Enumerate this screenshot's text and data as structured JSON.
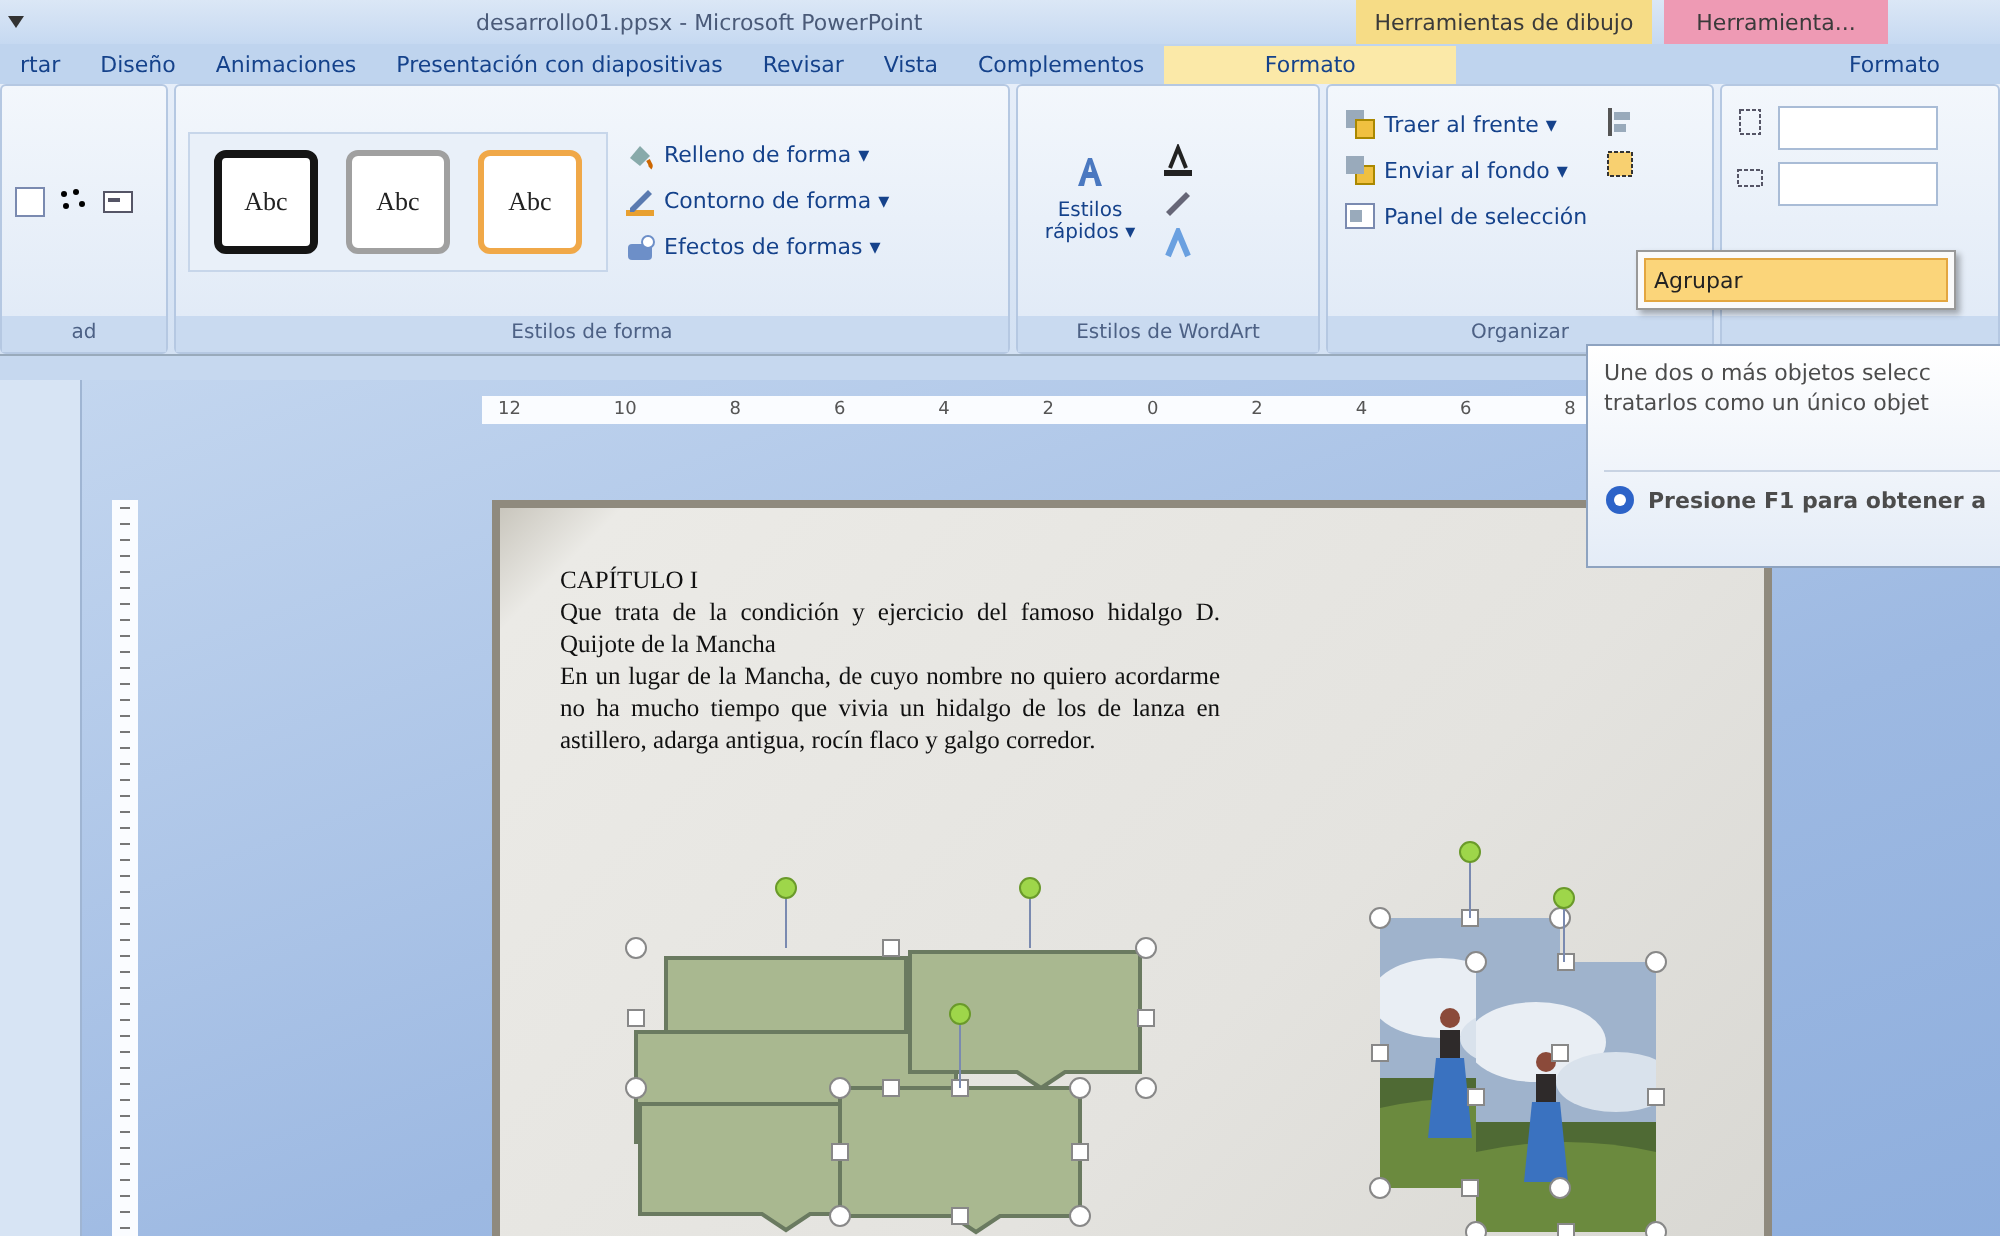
{
  "window": {
    "title": "desarrollo01.ppsx - Microsoft PowerPoint"
  },
  "context_tabs": [
    {
      "label": "Herramientas de dibujo",
      "color": "#f6dc86"
    },
    {
      "label": "Herramienta...",
      "color": "#ee9ab4"
    }
  ],
  "tabs": [
    {
      "label": "rtar",
      "selected": false
    },
    {
      "label": "Diseño",
      "selected": false
    },
    {
      "label": "Animaciones",
      "selected": false
    },
    {
      "label": "Presentación con diapositivas",
      "selected": false
    },
    {
      "label": "Revisar",
      "selected": false
    },
    {
      "label": "Vista",
      "selected": false
    },
    {
      "label": "Complementos",
      "selected": false
    },
    {
      "label": "Formato",
      "selected": true
    },
    {
      "label": "Formato",
      "selected": false
    }
  ],
  "ribbon": {
    "left_group_label": "ad",
    "shape_styles": {
      "gallery": [
        {
          "label": "Abc",
          "color": "#151515"
        },
        {
          "label": "Abc",
          "color": "#a0a0a0"
        },
        {
          "label": "Abc",
          "color": "#f0a848"
        }
      ],
      "commands": [
        "Relleno de forma ▾",
        "Contorno de forma ▾",
        "Efectos de formas ▾"
      ],
      "label": "Estilos de forma"
    },
    "wordart": {
      "quick_styles": "Estilos rápidos ▾",
      "label": "Estilos de WordArt"
    },
    "arrange": {
      "commands": [
        "Traer al frente ▾",
        "Enviar al fondo ▾",
        "Panel de selección"
      ],
      "label": "Organizar"
    }
  },
  "arrange_menu": {
    "items": [
      {
        "label": "Agrupar",
        "selected": true
      }
    ]
  },
  "tooltip": {
    "lines": [
      "Une dos o más objetos selecc",
      "tratarlos como un único objet"
    ],
    "help": "Presione F1 para obtener a"
  },
  "ruler": {
    "labels": [
      "12",
      "10",
      "8",
      "6",
      "4",
      "2",
      "0",
      "2",
      "4",
      "6",
      "8"
    ]
  },
  "slide": {
    "heading": "CAPÍTULO I",
    "subtitle": "Que trata de la condición y ejercicio del famoso hidalgo D. Quijote de la Mancha",
    "body": " En un lugar de la Mancha, de cuyo nombre no quiero acordarme no ha mucho tiempo que vivia un hidalgo de los de lanza en astillero, adarga antigua, rocín flaco y galgo corredor.",
    "shape_groups": [
      {
        "kind": "callouts",
        "selected": true
      },
      {
        "kind": "pictures",
        "selected": true
      }
    ]
  }
}
